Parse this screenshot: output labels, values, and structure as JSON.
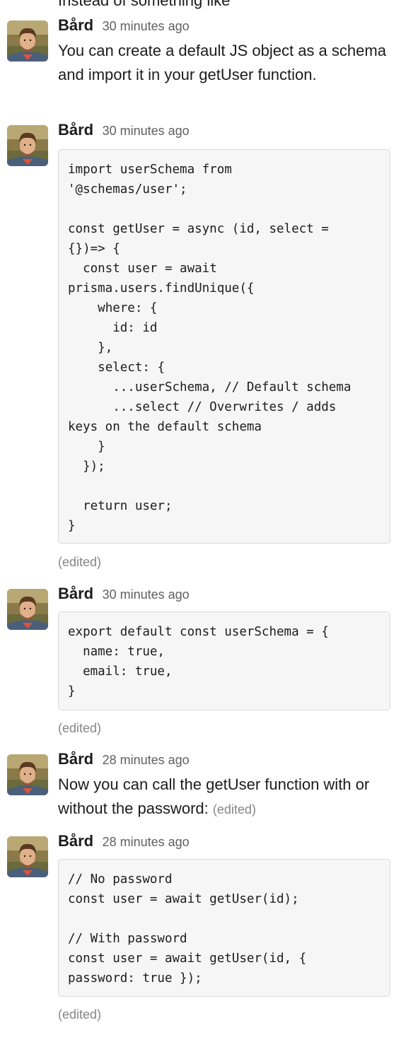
{
  "colors": {
    "text": "#1d1c1d",
    "timestamp": "#616061",
    "edited": "#868686",
    "code_bg": "#f6f6f6",
    "code_border": "#d9d9d9"
  },
  "top_cut_text": "Instead of something like",
  "messages": [
    {
      "author": "Bård",
      "time": "30 minutes ago",
      "text": "You can create a default JS object as a schema and import it in your getUser function."
    },
    {
      "author": "Bård",
      "time": "30 minutes ago",
      "code": "import userSchema from\n'@schemas/user';\n\nconst getUser = async (id, select =\n{})=> {\n  const user = await\nprisma.users.findUnique({\n    where: {\n      id: id\n    },\n    select: {\n      ...userSchema, // Default schema\n      ...select // Overwrites / adds\nkeys on the default schema\n    }\n  });\n\n  return user;\n}",
      "edited": "(edited)"
    },
    {
      "author": "Bård",
      "time": "30 minutes ago",
      "code": "export default const userSchema = {\n  name: true,\n  email: true,\n}",
      "edited": "(edited)"
    },
    {
      "author": "Bård",
      "time": "28 minutes ago",
      "text": "Now you can call the getUser function with or without the password:",
      "edited": "(edited)"
    },
    {
      "author": "Bård",
      "time": "28 minutes ago",
      "code": "// No password\nconst user = await getUser(id);\n\n// With password\nconst user = await getUser(id, {\npassword: true });",
      "edited": "(edited)"
    }
  ]
}
